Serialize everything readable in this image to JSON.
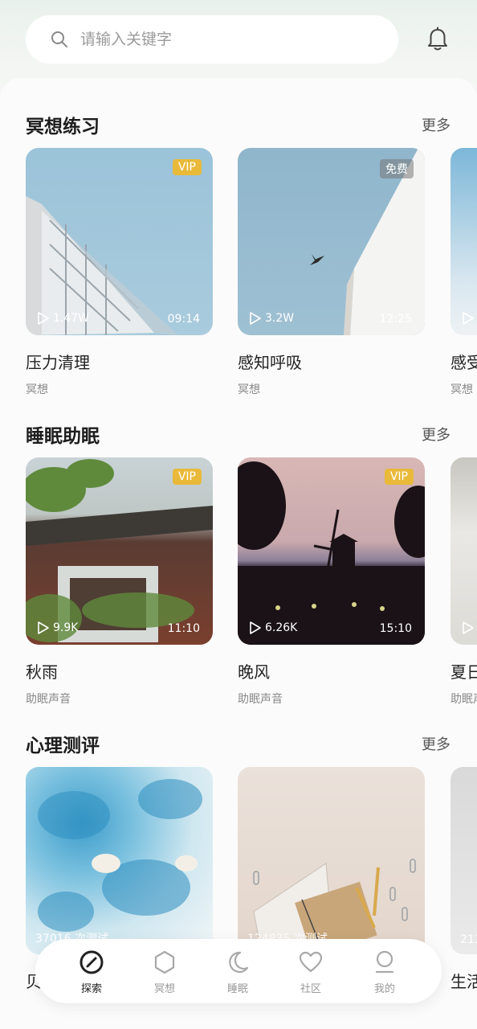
{
  "search": {
    "placeholder": "请输入关键字"
  },
  "sections": [
    {
      "title": "冥想练习",
      "more": "更多",
      "cards": [
        {
          "title": "压力清理",
          "sub": "冥想",
          "badge": "VIP",
          "plays": "1.47W",
          "duration": "09:14"
        },
        {
          "title": "感知呼吸",
          "sub": "冥想",
          "badge": "免费",
          "plays": "3.2W",
          "duration": "12:25"
        },
        {
          "title": "感受",
          "sub": "冥想"
        }
      ]
    },
    {
      "title": "睡眠助眠",
      "more": "更多",
      "cards": [
        {
          "title": "秋雨",
          "sub": "助眠声音",
          "badge": "VIP",
          "plays": "9.9K",
          "duration": "11:10"
        },
        {
          "title": "晚风",
          "sub": "助眠声音",
          "badge": "VIP",
          "plays": "6.26K",
          "duration": "15:10"
        },
        {
          "title": "夏日",
          "sub": "助眠声"
        }
      ]
    },
    {
      "title": "心理测评",
      "more": "更多",
      "cards": [
        {
          "title": "贝",
          "tests": "37016 次测试"
        },
        {
          "title": "",
          "tests": "124835 次测试"
        },
        {
          "title": "生活",
          "tests": "213"
        }
      ]
    }
  ],
  "tabs": [
    {
      "label": "探索",
      "icon": "compass-icon",
      "active": true
    },
    {
      "label": "冥想",
      "icon": "hexagon-icon"
    },
    {
      "label": "睡眠",
      "icon": "moon-icon"
    },
    {
      "label": "社区",
      "icon": "heart-icon"
    },
    {
      "label": "我的",
      "icon": "person-icon"
    }
  ]
}
